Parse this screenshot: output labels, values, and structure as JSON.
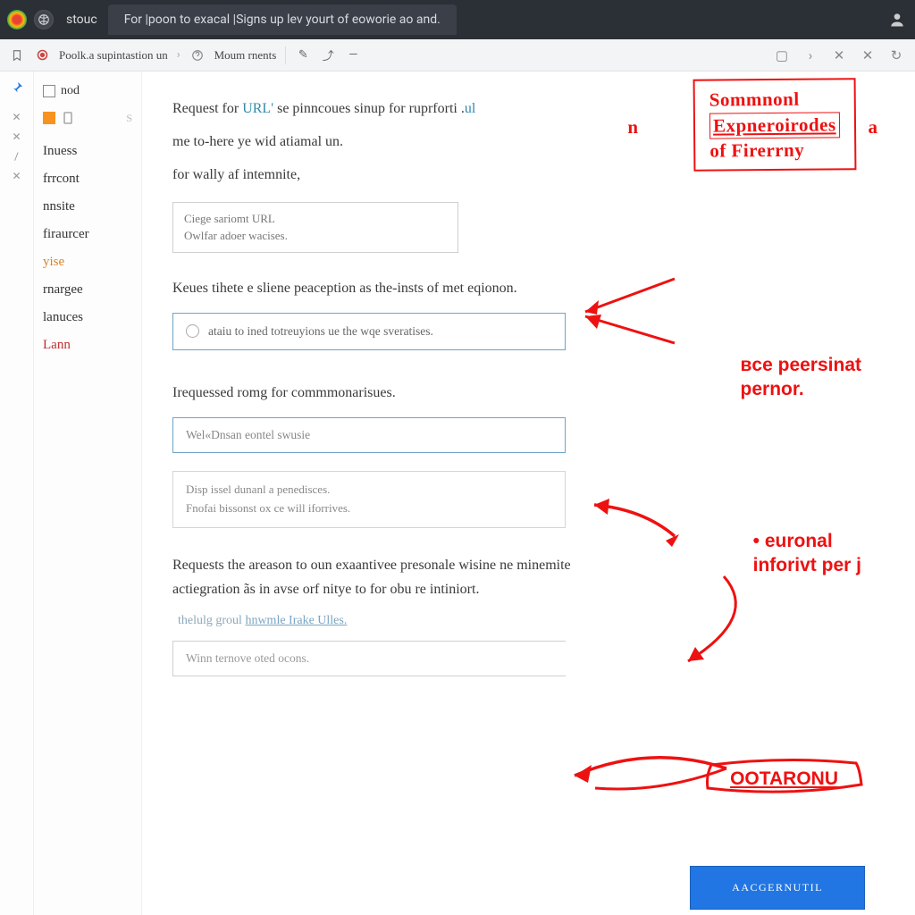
{
  "titlebar": {
    "site_label": "stouc",
    "tab_text": "For |poon to exacal |Signs up lev yourt of eoworie ao and."
  },
  "toolbar": {
    "crumb1": "Poolk.a supintastion un",
    "crumb2": "Moum rnents"
  },
  "sidebar": {
    "row1_label": "nod",
    "row3_badge": "S",
    "items": [
      {
        "label": "Inuess",
        "cls": ""
      },
      {
        "label": "frrcont",
        "cls": ""
      },
      {
        "label": "nnsite",
        "cls": ""
      },
      {
        "label": "firaurcer",
        "cls": ""
      },
      {
        "label": "yise",
        "cls": "orange"
      },
      {
        "label": "rnargee",
        "cls": ""
      },
      {
        "label": "lanuces",
        "cls": ""
      },
      {
        "label": "Lann",
        "cls": "red"
      }
    ]
  },
  "main": {
    "intro_1a": "Request for ",
    "intro_1b": "URL'",
    "intro_1c": " se pinncoues sinup for ruprforti .",
    "intro_1d": "ul",
    "intro_2": "me to-here ye wid atiamal un.",
    "intro_3": "for wally af intemnite,",
    "smallbox_l1": "Ciege sariomt URL",
    "smallbox_l2": "Owlfar adoer wacises.",
    "section_1": "Keues tihete e sliene peaception as the-insts of met eqionon.",
    "radio_text": "ataiu to ined totreuyions ue the wqe sveratises.",
    "section_2": "Irequessed romg for commmonarisues.",
    "input_placeholder": "Wel«Dnsan eontel swusie",
    "note_l1": "Disp issel dunanl a penedisces.",
    "note_l2": "Fnofai bissonst ox ce will iforrives.",
    "section_3": "Requests the areason to oun exaantivee presonale wisine ne minemite actiegration ãs in avse orf nitye to for obu re intiniort.",
    "hint_pre": "thelulg groul ",
    "hint_link": "hnwmle Irake Ulles.",
    "last_input_placeholder": "Winn ternove oted ocons.",
    "submit_label": "AACGERNUTIL"
  },
  "annotations": {
    "stamp_pre": "n",
    "stamp_l1": "Sommnonl",
    "stamp_l2": "Expneroirodes",
    "stamp_l3": "of Firerrny",
    "stamp_suf": "a",
    "a1_l1": "вce peersinat",
    "a1_l2": "pernor.",
    "a2_l1": "euronal",
    "a2_l2": "inforivt per j",
    "a3": "OOTARONU"
  }
}
